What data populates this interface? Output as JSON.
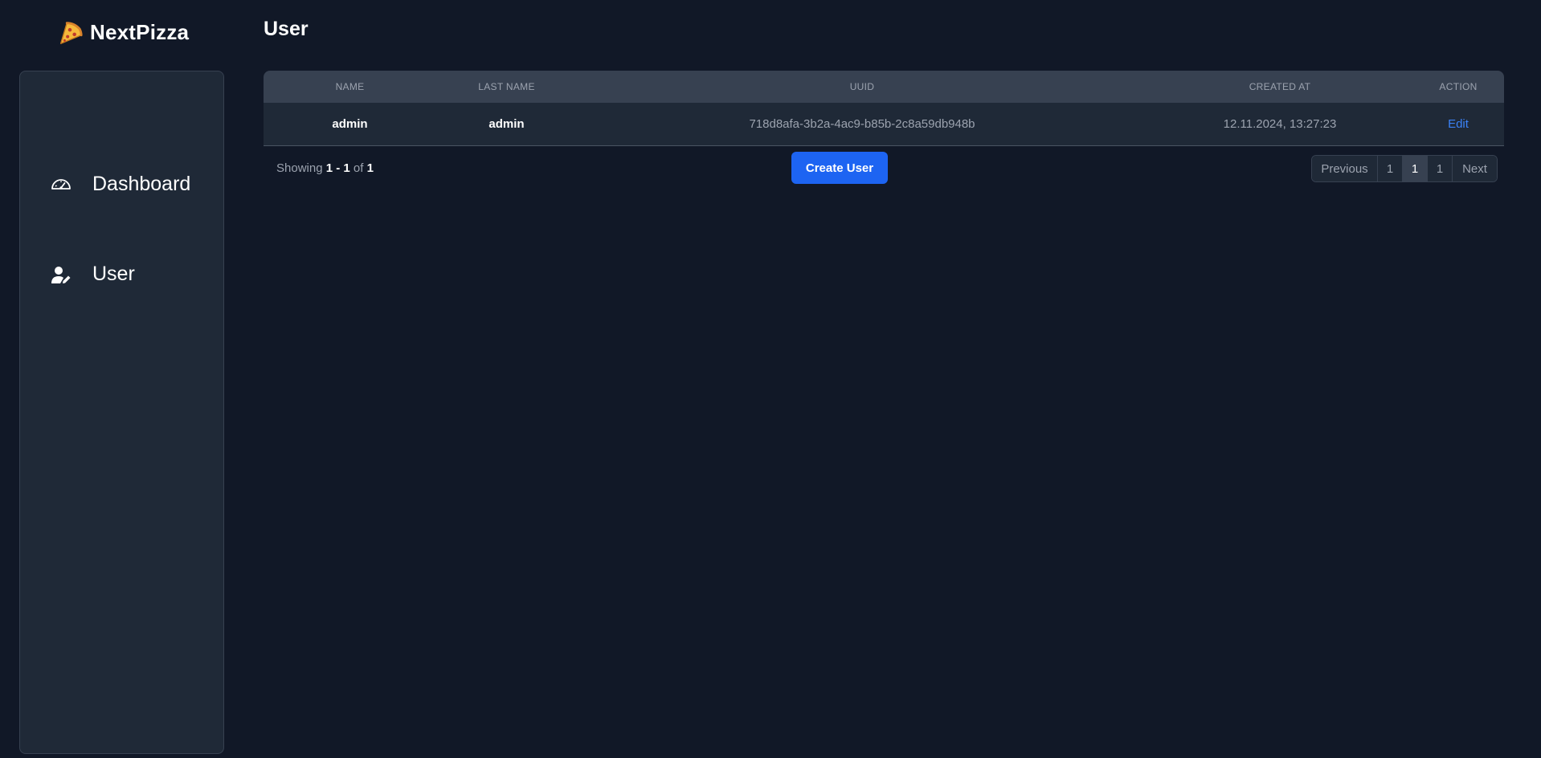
{
  "app": {
    "logo_text": "NextPizza",
    "logo_icon": "pizza-slice-icon"
  },
  "sidebar": {
    "items": [
      {
        "label": "Dashboard",
        "icon": "gauge-icon"
      },
      {
        "label": "User",
        "icon": "user-edit-icon"
      }
    ]
  },
  "page": {
    "title": "User"
  },
  "table": {
    "columns": [
      "NAME",
      "LAST NAME",
      "UUID",
      "CREATED AT",
      "ACTION"
    ],
    "rows": [
      {
        "name": "admin",
        "last_name": "admin",
        "uuid": "718d8afa-3b2a-4ac9-b85b-2c8a59db948b",
        "created_at": "12.11.2024, 13:27:23",
        "action": "Edit"
      }
    ]
  },
  "footer": {
    "showing_prefix": "Showing",
    "showing_range": "1 - 1",
    "showing_of": "of",
    "showing_total": "1",
    "create_button": "Create User"
  },
  "pagination": {
    "previous": "Previous",
    "pages": [
      "1",
      "1",
      "1"
    ],
    "active_index": 1,
    "next": "Next"
  },
  "colors": {
    "background": "#111827",
    "panel": "#1f2937",
    "header": "#374151",
    "accent": "#1d64f2",
    "link": "#3b82f6",
    "muted_text": "#9ca3af"
  }
}
